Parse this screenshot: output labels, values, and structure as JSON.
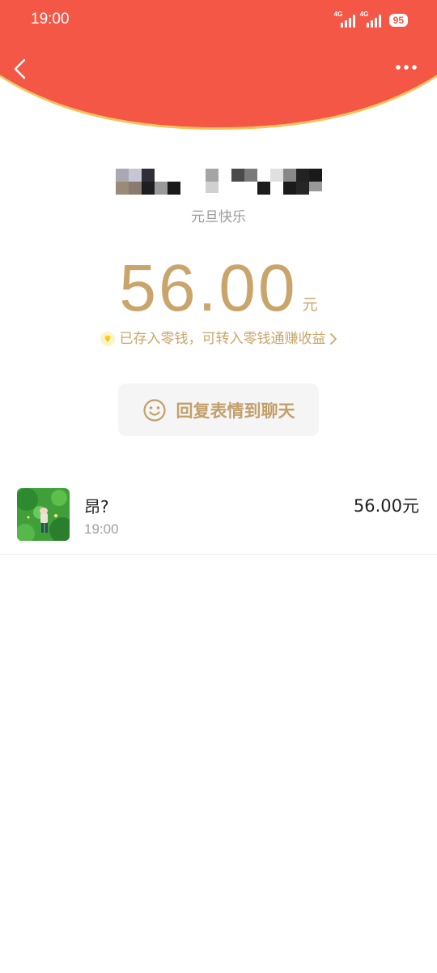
{
  "status_bar": {
    "time": "19:00",
    "network_1": "4G",
    "network_2": "4G",
    "battery": "95"
  },
  "header": {
    "back_icon": "chevron-left-icon",
    "more_icon": "more-dots-icon",
    "colors": {
      "background": "#f45745",
      "rim": "#f6c25c"
    }
  },
  "envelope": {
    "message": "元旦快乐",
    "amount": "56.00",
    "unit": "元",
    "notice": "已存入零钱，可转入零钱通赚收益",
    "reply_label": "回复表情到聊天",
    "accent_color": "#c9a56b"
  },
  "records": [
    {
      "name": "昂?",
      "time": "19:00",
      "amount": "56.00元"
    }
  ]
}
